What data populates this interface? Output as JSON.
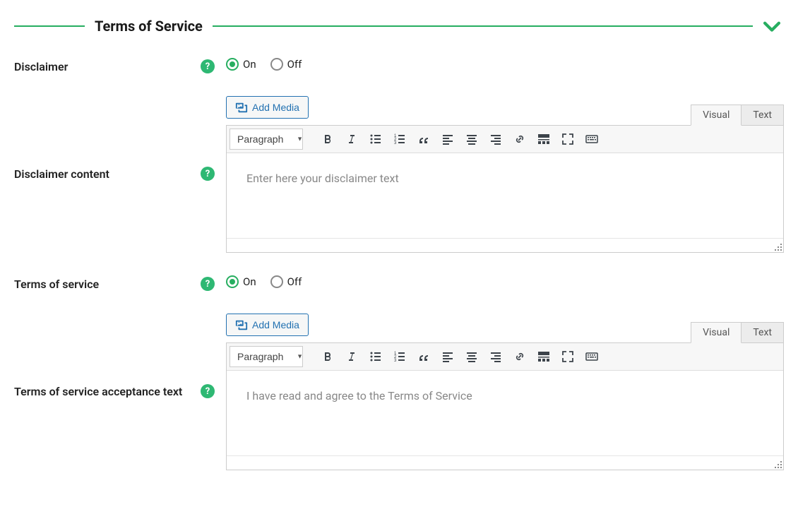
{
  "section": {
    "title": "Terms of Service"
  },
  "radio": {
    "on": "On",
    "off": "Off"
  },
  "format_option": "Paragraph",
  "add_media_label": "Add Media",
  "tabs": {
    "visual": "Visual",
    "text": "Text"
  },
  "fields": {
    "disclaimer": {
      "label": "Disclaimer",
      "value": "on"
    },
    "disclaimer_content": {
      "label": "Disclaimer content",
      "editor_text": "Enter here your disclaimer text"
    },
    "tos": {
      "label": "Terms of service",
      "value": "on"
    },
    "tos_acceptance": {
      "label": "Terms of service acceptance text",
      "editor_text": "I have read and agree to the Terms of Service"
    }
  },
  "icons": {
    "help": "?"
  }
}
